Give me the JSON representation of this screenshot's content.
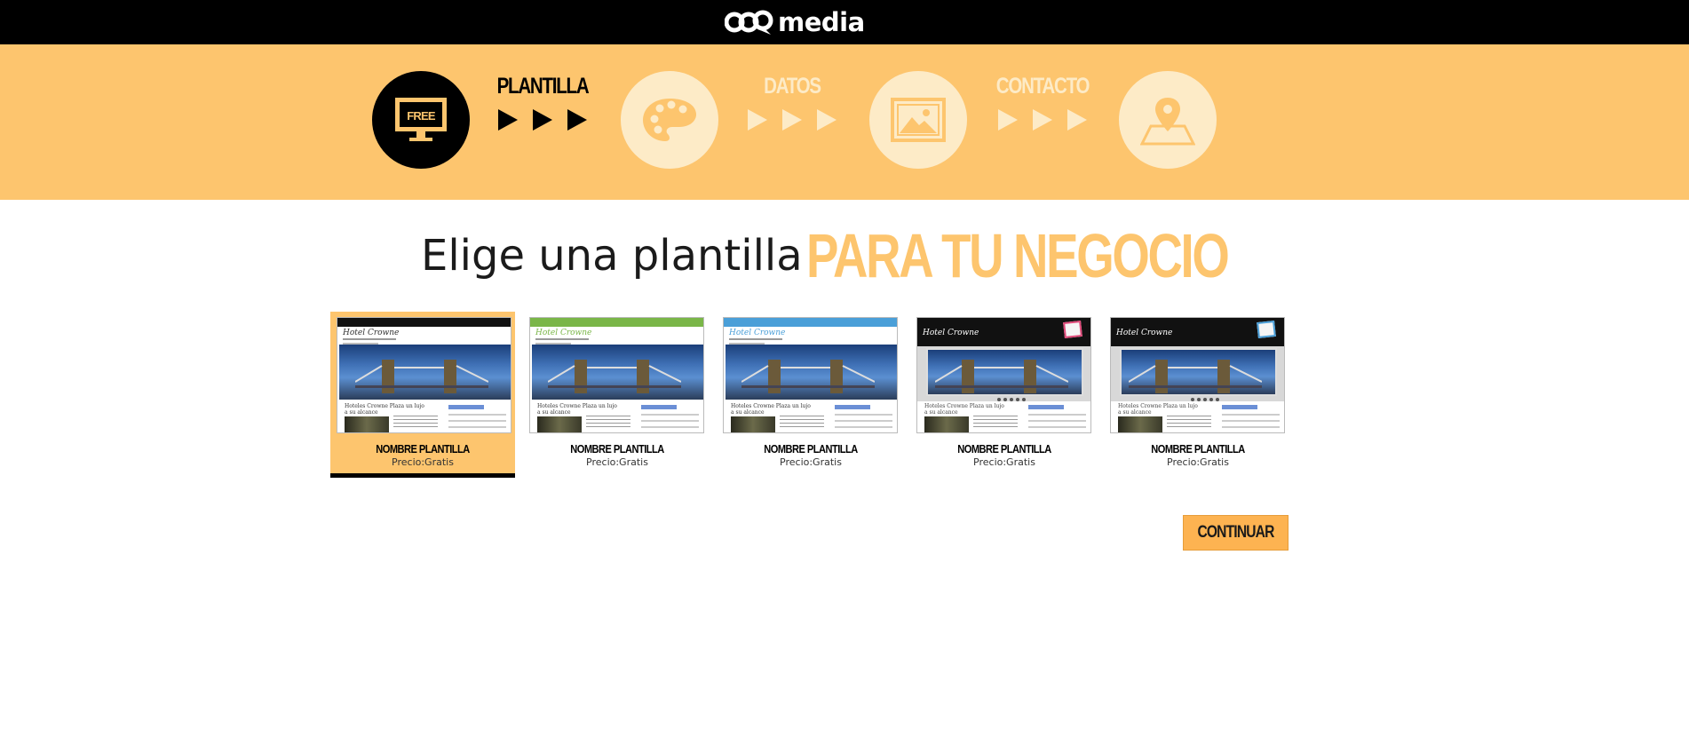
{
  "header": {
    "logo_text": "media",
    "logo_icon": "ooq-speech-bubble-logo"
  },
  "steps": [
    {
      "label": "PLANTILLA",
      "icon": "monitor-icon",
      "icon_text": "FREE",
      "active": true
    },
    {
      "label": "DATOS",
      "icon": "palette-icon",
      "active": false
    },
    {
      "label": "CONTACTO",
      "icon": "image-icon",
      "active": false
    },
    {
      "label": "",
      "icon": "map-pin-icon",
      "active": false
    }
  ],
  "headline": {
    "light": "Elige una plantilla",
    "bold": "PARA TU NEGOCIO"
  },
  "templates": [
    {
      "name": "NOMBRE PLANTILLA",
      "price": "Precio:Gratis",
      "selected": true,
      "accent": "#111111",
      "site_title": "Hotel Crowne",
      "body_title": "Hoteles Crowne Plaza un lujo a su alcance"
    },
    {
      "name": "NOMBRE PLANTILLA",
      "price": "Precio:Gratis",
      "selected": false,
      "accent": "#7ab648",
      "site_title": "Hotel Crowne",
      "body_title": "Hoteles Crowne Plaza un lujo a su alcance"
    },
    {
      "name": "NOMBRE PLANTILLA",
      "price": "Precio:Gratis",
      "selected": false,
      "accent": "#4a9fd8",
      "site_title": "Hotel Crowne",
      "body_title": "Hoteles Crowne Plaza un lujo a su alcance"
    },
    {
      "name": "NOMBRE PLANTILLA",
      "price": "Precio:Gratis",
      "selected": false,
      "accent": "#e04a7a",
      "site_title": "Hotel Crowne",
      "body_title": "Hoteles Crowne Plaza un lujo a su alcance"
    },
    {
      "name": "NOMBRE PLANTILLA",
      "price": "Precio:Gratis",
      "selected": false,
      "accent": "#4a9fd8",
      "site_title": "Hotel Crowne",
      "body_title": "Hoteles Crowne Plaza un lujo a su alcance"
    }
  ],
  "continue_label": "CONTINUAR",
  "colors": {
    "brand_yellow": "#fdc56e",
    "pale_yellow": "#fdebc7",
    "button": "#fdb351"
  }
}
